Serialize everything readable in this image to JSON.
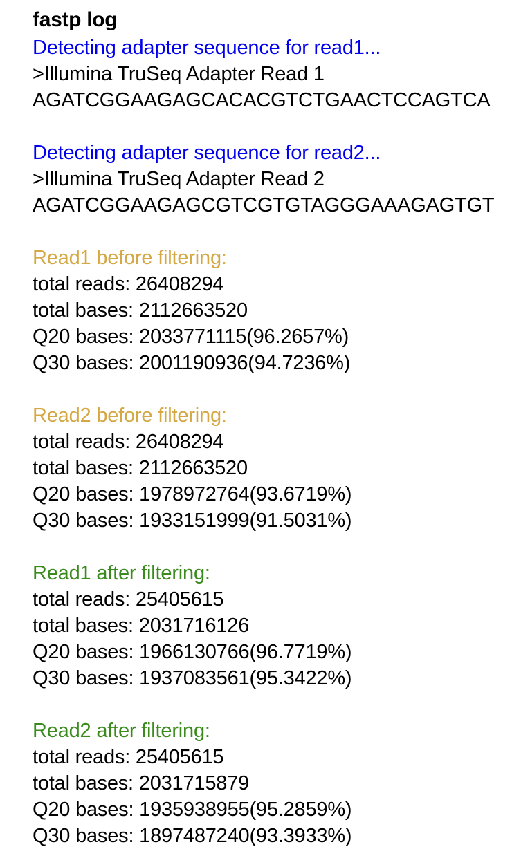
{
  "title": "fastp log",
  "colors": {
    "adapter_heading": "#0000ee",
    "before_heading": "#d4a843",
    "after_heading": "#3a8a1e",
    "body_text": "#000000"
  },
  "adapters": [
    {
      "heading": "Detecting adapter sequence for read1...",
      "name": ">Illumina TruSeq Adapter Read 1",
      "sequence": "AGATCGGAAGAGCACACGTCTGAACTCCAGTCA"
    },
    {
      "heading": "Detecting adapter sequence for read2...",
      "name": ">Illumina TruSeq Adapter Read 2",
      "sequence": "AGATCGGAAGAGCGTCGTGTAGGGAAAGAGTGT"
    }
  ],
  "sections": [
    {
      "heading": "Read1 before filtering:",
      "total_reads": "total reads: 26408294",
      "total_bases": "total bases: 2112663520",
      "q20": "Q20 bases: 2033771115(96.2657%)",
      "q30": "Q30 bases: 2001190936(94.7236%)"
    },
    {
      "heading": "Read2 before filtering:",
      "total_reads": "total reads: 26408294",
      "total_bases": "total bases: 2112663520",
      "q20": "Q20 bases: 1978972764(93.6719%)",
      "q30": "Q30 bases: 1933151999(91.5031%)"
    },
    {
      "heading": "Read1 after filtering:",
      "total_reads": "total reads: 25405615",
      "total_bases": "total bases: 2031716126",
      "q20": "Q20 bases: 1966130766(96.7719%)",
      "q30": "Q30 bases: 1937083561(95.3422%)"
    },
    {
      "heading": "Read2 after filtering:",
      "total_reads": "total reads: 25405615",
      "total_bases": "total bases: 2031715879",
      "q20": "Q20 bases: 1935938955(95.2859%)",
      "q30": "Q30 bases: 1897487240(93.3933%)"
    }
  ]
}
